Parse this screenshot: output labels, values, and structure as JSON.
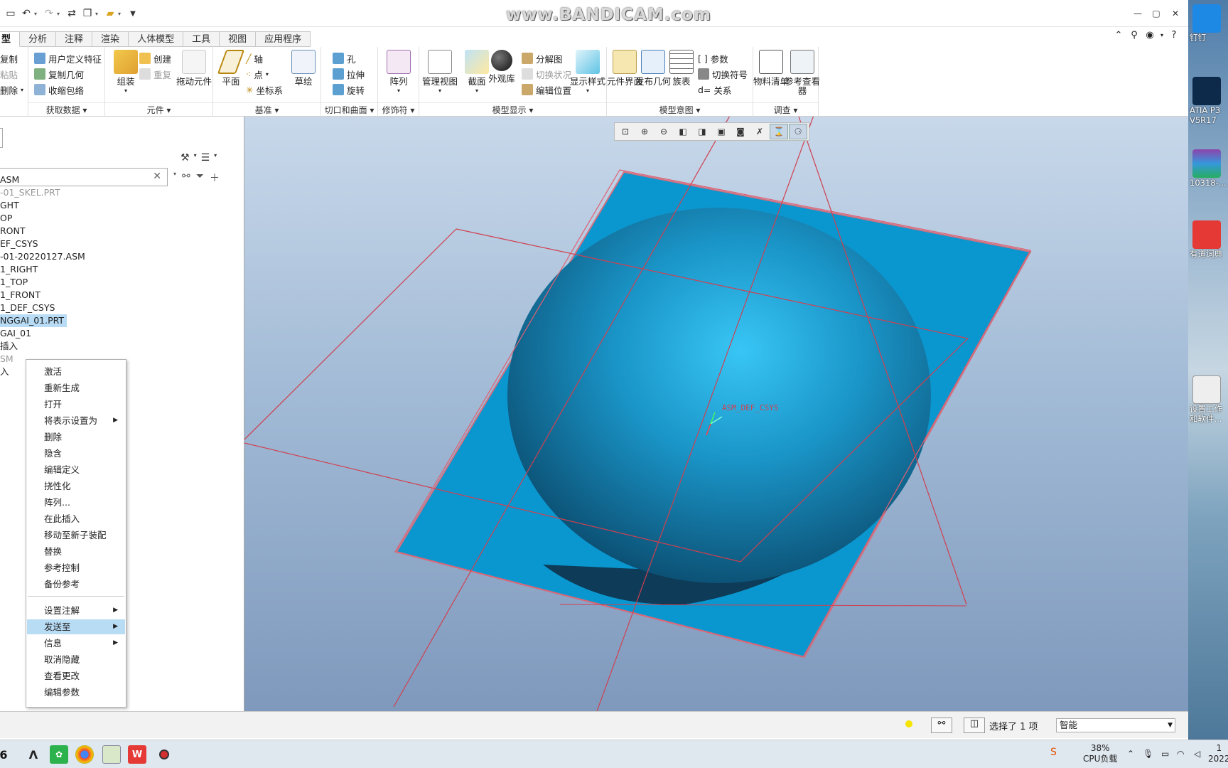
{
  "titlebar": {
    "title": "www.BANDICAM.com"
  },
  "tabs": [
    {
      "label": "型",
      "active": true
    },
    {
      "label": "分析"
    },
    {
      "label": "注释"
    },
    {
      "label": "渲染"
    },
    {
      "label": "人体模型"
    },
    {
      "label": "工具"
    },
    {
      "label": "视图"
    },
    {
      "label": "应用程序"
    }
  ],
  "ribbon": {
    "groups": {
      "get_data": "获取数据",
      "component": "元件",
      "datum": "基准",
      "cut_surface": "切口和曲面",
      "modifiers": "修饰符",
      "model_display": "模型显示",
      "model_intent": "模型意图",
      "investigate": "调查"
    },
    "buttons": {
      "copy": "复制",
      "paste": "粘贴",
      "delete": "删除",
      "user_feature": "用户定义特征",
      "copy_geom": "复制几何",
      "shrinkwrap": "收缩包络",
      "assemble": "组装",
      "create": "创建",
      "repeat": "重复",
      "drag": "拖动元件",
      "plane": "平面",
      "axis": "轴",
      "point": "点",
      "csys": "坐标系",
      "sketch": "草绘",
      "hole": "孔",
      "extrude": "拉伸",
      "revolve": "旋转",
      "pattern": "阵列",
      "manage_views": "管理视图",
      "section": "截面",
      "appearance": "外观库",
      "explode": "分解图",
      "toggle_status": "切换状况",
      "edit_position": "编辑位置",
      "display_style": "显示样式",
      "comp_interface": "元件界面",
      "publish_geom": "发布几何",
      "family_table": "族表",
      "params": "参数",
      "toggle_symbols": "切换符号",
      "relations": "关系",
      "bom": "物料清单",
      "ref_viewer": "参考查看器"
    }
  },
  "tree": {
    "search_clear": "✕",
    "items": [
      {
        "label": "ASM",
        "gray": false
      },
      {
        "label": "-01_SKEL.PRT",
        "gray": true
      },
      {
        "label": "GHT",
        "gray": false
      },
      {
        "label": "OP",
        "gray": false
      },
      {
        "label": "RONT",
        "gray": false
      },
      {
        "label": "EF_CSYS",
        "gray": false
      },
      {
        "label": "-01-20220127.ASM",
        "gray": false
      },
      {
        "label": "1_RIGHT",
        "gray": false
      },
      {
        "label": "1_TOP",
        "gray": false
      },
      {
        "label": "1_FRONT",
        "gray": false
      },
      {
        "label": "1_DEF_CSYS",
        "gray": false
      },
      {
        "label": "NGGAI_01.PRT",
        "gray": false,
        "selected": true
      },
      {
        "label": "GAI_01",
        "gray": false
      },
      {
        "label": "插入",
        "gray": false
      },
      {
        "label": "SM",
        "gray": true
      },
      {
        "label": "入",
        "gray": false
      }
    ]
  },
  "context_menu": {
    "items": [
      {
        "label": "激活"
      },
      {
        "label": "重新生成"
      },
      {
        "label": "打开"
      },
      {
        "label": "将表示设置为",
        "submenu": true
      },
      {
        "label": "删除"
      },
      {
        "label": "隐含"
      },
      {
        "label": "编辑定义"
      },
      {
        "label": "挠性化"
      },
      {
        "label": "阵列..."
      },
      {
        "label": "在此插入"
      },
      {
        "label": "移动至新子装配"
      },
      {
        "label": "替换"
      },
      {
        "label": "参考控制"
      },
      {
        "label": "备份参考"
      },
      {
        "label": "设置注解",
        "submenu": true
      },
      {
        "label": "发送至",
        "submenu": true,
        "highlighted": true
      },
      {
        "label": "信息",
        "submenu": true
      },
      {
        "label": "取消隐藏"
      },
      {
        "label": "查看更改"
      },
      {
        "label": "编辑参数"
      }
    ]
  },
  "viewport": {
    "csys_label": "ASM_DEF_CSYS",
    "background_top": "#c8d8ea",
    "background_bottom": "#7f99bd",
    "model_color": "#1f8fc4"
  },
  "statusbar": {
    "selection": "选择了 1 项",
    "filter_value": "智能"
  },
  "taskbar": {
    "cpu_percent": "38%",
    "cpu_label": "CPU负载",
    "clock_time": "1",
    "clock_date": "2022"
  },
  "desktop": {
    "icons": [
      {
        "label": "钉钉"
      },
      {
        "label": "ATIA P3 V5R17"
      },
      {
        "label": "10318-..."
      },
      {
        "label": "有道词典"
      },
      {
        "label": "设置工作 和软件..."
      }
    ]
  }
}
